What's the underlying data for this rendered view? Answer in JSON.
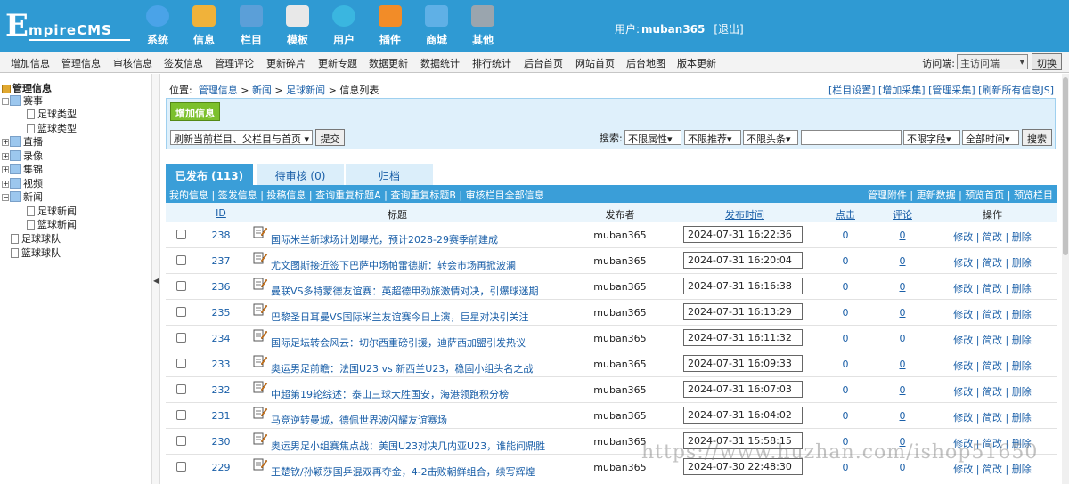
{
  "header": {
    "logo_big": "E",
    "logo_rest": "mpireCMS",
    "nav": [
      {
        "label": "系统",
        "icon": "globe-icon",
        "color": "#4aa3e8"
      },
      {
        "label": "信息",
        "icon": "document-edit-icon",
        "color": "#f0b23a"
      },
      {
        "label": "栏目",
        "icon": "folder-icon",
        "color": "#5b9fd8"
      },
      {
        "label": "模板",
        "icon": "window-icon",
        "color": "#e8e8e8"
      },
      {
        "label": "用户",
        "icon": "user-icon",
        "color": "#3ab6e0"
      },
      {
        "label": "插件",
        "icon": "tools-icon",
        "color": "#f28c28"
      },
      {
        "label": "商城",
        "icon": "shop-card-icon",
        "color": "#5fb0e6"
      },
      {
        "label": "其他",
        "icon": "gear-icon",
        "color": "#9aa5ae"
      }
    ],
    "user_prefix": "用户:",
    "username": "muban365",
    "logout": "[退出]"
  },
  "menubar": {
    "items": [
      "增加信息",
      "管理信息",
      "审核信息",
      "签发信息",
      "管理评论",
      "更新碎片",
      "更新专题",
      "数据更新",
      "数据统计",
      "排行统计",
      "后台首页",
      "网站首页",
      "后台地图",
      "版本更新"
    ],
    "visit_label": "访问端:",
    "visit_value": "主访问端",
    "switch": "切换"
  },
  "sidebar": {
    "root": "管理信息",
    "nodes": [
      {
        "label": "赛事",
        "kind": "folder"
      },
      {
        "label": "足球类型",
        "kind": "page"
      },
      {
        "label": "篮球类型",
        "kind": "page"
      },
      {
        "label": "直播",
        "kind": "folder"
      },
      {
        "label": "录像",
        "kind": "folder"
      },
      {
        "label": "集锦",
        "kind": "folder"
      },
      {
        "label": "视频",
        "kind": "folder"
      },
      {
        "label": "新闻",
        "kind": "folder"
      },
      {
        "label": "足球新闻",
        "kind": "page"
      },
      {
        "label": "篮球新闻",
        "kind": "page"
      },
      {
        "label": "足球球队",
        "kind": "page"
      },
      {
        "label": "篮球球队",
        "kind": "page"
      }
    ]
  },
  "main": {
    "crumb_label": "位置:",
    "crumbs": [
      "管理信息",
      "新闻",
      "足球新闻",
      "信息列表"
    ],
    "right_links": "[栏目设置] [增加采集] [管理采集] [刷新所有信息JS]",
    "add_button": "增加信息",
    "refresh_select": "刷新当前栏目、父栏目与首页",
    "submit": "提交",
    "search_label": "搜索:",
    "filters": [
      "不限属性",
      "不限推荐",
      "不限头条"
    ],
    "search_value": "",
    "field_select": "不限字段",
    "time_select": "全部时间",
    "search_button": "搜索",
    "tabs": [
      {
        "label": "已发布 (113)",
        "active": true
      },
      {
        "label": "待审核 (0)",
        "active": false
      },
      {
        "label": "归档",
        "active": false
      }
    ],
    "linkbar_left": "我的信息 | 签发信息 | 投稿信息 | 查询重复标题A | 查询重复标题B | 审核栏目全部信息",
    "linkbar_right": "管理附件 | 更新数据 | 预览首页 | 预览栏目",
    "columns": {
      "id": "ID",
      "title": "标题",
      "publisher": "发布者",
      "time": "发布时间",
      "clicks": "点击",
      "comments": "评论",
      "ops": "操作"
    },
    "rows": [
      {
        "id": "238",
        "title": "国际米兰新球场计划曝光，预计2028-29赛季前建成",
        "publisher": "muban365",
        "time": "2024-07-31 16:22:36",
        "clicks": "0",
        "comments": "0",
        "ops": "修改 | 简改 | 删除"
      },
      {
        "id": "237",
        "title": "尤文图斯接近签下巴萨中场帕雷德斯：转会市场再掀波澜",
        "publisher": "muban365",
        "time": "2024-07-31 16:20:04",
        "clicks": "0",
        "comments": "0",
        "ops": "修改 | 简改 | 删除"
      },
      {
        "id": "236",
        "title": "曼联VS多特蒙德友谊赛：英超德甲劲旅激情对决，引爆球迷期",
        "publisher": "muban365",
        "time": "2024-07-31 16:16:38",
        "clicks": "0",
        "comments": "0",
        "ops": "修改 | 简改 | 删除"
      },
      {
        "id": "235",
        "title": "巴黎圣日耳曼VS国际米兰友谊赛今日上演，巨星对决引关注",
        "publisher": "muban365",
        "time": "2024-07-31 16:13:29",
        "clicks": "0",
        "comments": "0",
        "ops": "修改 | 简改 | 删除"
      },
      {
        "id": "234",
        "title": "国际足坛转会风云：切尔西重磅引援，迪萨西加盟引发热议",
        "publisher": "muban365",
        "time": "2024-07-31 16:11:32",
        "clicks": "0",
        "comments": "0",
        "ops": "修改 | 简改 | 删除"
      },
      {
        "id": "233",
        "title": "奥运男足前瞻：法国U23 vs 新西兰U23，稳固小组头名之战",
        "publisher": "muban365",
        "time": "2024-07-31 16:09:33",
        "clicks": "0",
        "comments": "0",
        "ops": "修改 | 简改 | 删除"
      },
      {
        "id": "232",
        "title": "中超第19轮综述：泰山三球大胜国安，海港领跑积分榜",
        "publisher": "muban365",
        "time": "2024-07-31 16:07:03",
        "clicks": "0",
        "comments": "0",
        "ops": "修改 | 简改 | 删除"
      },
      {
        "id": "231",
        "title": "马竞逆转曼城，德佩世界波闪耀友谊赛场",
        "publisher": "muban365",
        "time": "2024-07-31 16:04:02",
        "clicks": "0",
        "comments": "0",
        "ops": "修改 | 简改 | 删除"
      },
      {
        "id": "230",
        "title": "奥运男足小组赛焦点战：美国U23对决几内亚U23，谁能问鼎胜",
        "publisher": "muban365",
        "time": "2024-07-31 15:58:15",
        "clicks": "0",
        "comments": "0",
        "ops": "修改 | 简改 | 删除"
      },
      {
        "id": "229",
        "title": "王楚钦/孙颖莎国乒混双再夺金，4-2击败朝鲜组合，续写辉煌",
        "publisher": "muban365",
        "time": "2024-07-30 22:48:30",
        "clicks": "0",
        "comments": "0",
        "ops": "修改 | 简改 | 删除"
      }
    ]
  },
  "watermark": "https://www.huzhan.com/ishop51650",
  "colors": {
    "topbar": "#2f9ad3",
    "add_button": "#7cc02d",
    "link": "#1a5fa8",
    "tab_active": "#3a9ed8",
    "tab_inactive": "#dbeefa"
  }
}
